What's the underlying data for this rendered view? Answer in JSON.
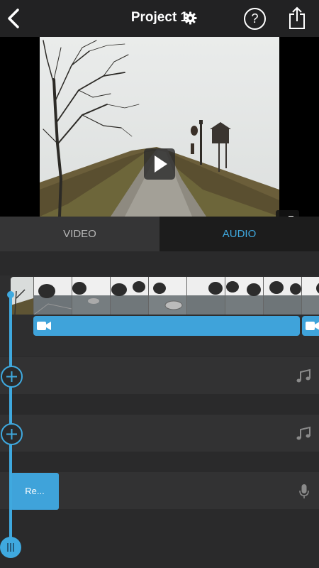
{
  "header": {
    "title": "Project 1",
    "help_label": "?"
  },
  "tabs": [
    {
      "label": "VIDEO",
      "active": false
    },
    {
      "label": "AUDIO",
      "active": true
    }
  ],
  "timeline": {
    "recording_clip_label": "Re..."
  },
  "colors": {
    "accent": "#3fa9df",
    "header_bg": "#222223",
    "tab_inactive_bg": "#353536",
    "timeline_bg": "#2a2a2b"
  },
  "icons": [
    "back-chevron-icon",
    "gear-icon",
    "help-icon",
    "share-icon",
    "play-icon",
    "fullscreen-icon",
    "camera-icon",
    "add-icon",
    "music-note-icon",
    "microphone-icon"
  ]
}
